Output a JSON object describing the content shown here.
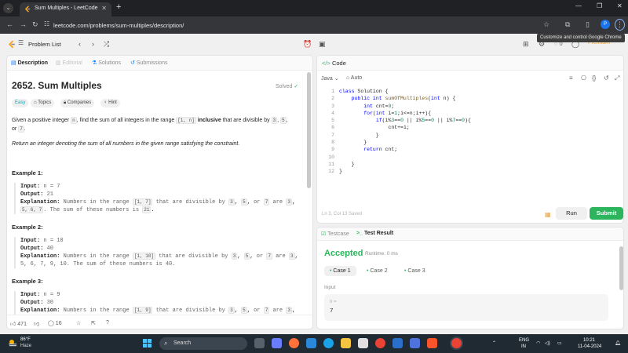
{
  "browser": {
    "tab_title": "Sum Multiples - LeetCode",
    "url": "leetcode.com/problems/sum-multiples/description/",
    "tooltip": "Customize and control Google Chrome",
    "profile_initial": "P"
  },
  "header": {
    "problem_list": "Problem List",
    "streak": "0",
    "premium": "Premium"
  },
  "left": {
    "tabs": [
      "Description",
      "Editorial",
      "Solutions",
      "Submissions"
    ],
    "title": "2652. Sum Multiples",
    "solved": "Solved",
    "tags": [
      "Easy",
      "Topics",
      "Companies",
      "Hint"
    ],
    "desc": {
      "p1_a": "Given a positive integer ",
      "p1_n": "n",
      "p1_b": ", find the sum of all integers in the range ",
      "p1_range": "[1, n]",
      "p1_bold": "inclusive",
      "p1_c": " that are divisible by ",
      "p1_3": "3",
      "p1_5": "5",
      "p1_d": "or",
      "p1_7": "7",
      "p2": "Return an integer denoting the sum of all numbers in the given range satisfying the constraint."
    },
    "examples": [
      {
        "title": "Example 1:",
        "input": "n = 7",
        "output": "21",
        "explanation_a": "Numbers in the range",
        "range": "[1, 7]",
        "explanation_b": "that are divisible by",
        "d3": "3",
        "d5": "5",
        "d7": "7",
        "line2_a": "5, 6, 7",
        "line2_b": ". The sum of these numbers is",
        "sum": "21"
      },
      {
        "title": "Example 2:",
        "input": "n = 10",
        "output": "40",
        "explanation_a": "Numbers in the range",
        "range": "[1, 10]",
        "explanation_b": "that are divisible by",
        "d3": "3",
        "d5": "5",
        "d7": "7",
        "line2": "5, 6, 7, 9, 10. The sum of these numbers is 40."
      },
      {
        "title": "Example 3:",
        "input": "n = 9",
        "output": "30",
        "explanation_a": "Numbers in the range",
        "range": "[1, 9]",
        "explanation_b": "that are divisible by",
        "d3": "3",
        "d5": "5",
        "d7": "7"
      }
    ],
    "labels": {
      "input": "Input:",
      "output": "Output:",
      "explanation": "Explanation:",
      "are": "are",
      "or": "or"
    },
    "footer": {
      "likes": "471",
      "comments": "16"
    }
  },
  "code_panel": {
    "label": "Code",
    "language": "Java",
    "mode": "Auto",
    "status": "Ln 3, Col 13    Saved",
    "run": "Run",
    "submit": "Submit",
    "lines": [
      "class Solution {",
      "    public int sumOfMultiples(int n) {",
      "        int cnt=0;",
      "        for(int i=1;i<=n;i++){",
      "            if(i%3==0 || i%5==0 || i%7==0){",
      "                cnt+=i;",
      "            }",
      "        }",
      "        return cnt;",
      "",
      "    }",
      "}"
    ]
  },
  "test_panel": {
    "tabs": [
      "Testcase",
      "Test Result"
    ],
    "result": "Accepted",
    "runtime": "Runtime: 0 ms",
    "cases": [
      "Case 1",
      "Case 2",
      "Case 3"
    ],
    "input_label": "Input",
    "input_var": "n =",
    "input_value": "7"
  },
  "taskbar": {
    "temp": "86°F",
    "weather": "Haze",
    "search": "Search",
    "lang_top": "ENG",
    "lang_bottom": "IN",
    "time": "10:21",
    "date": "11-04-2024"
  }
}
